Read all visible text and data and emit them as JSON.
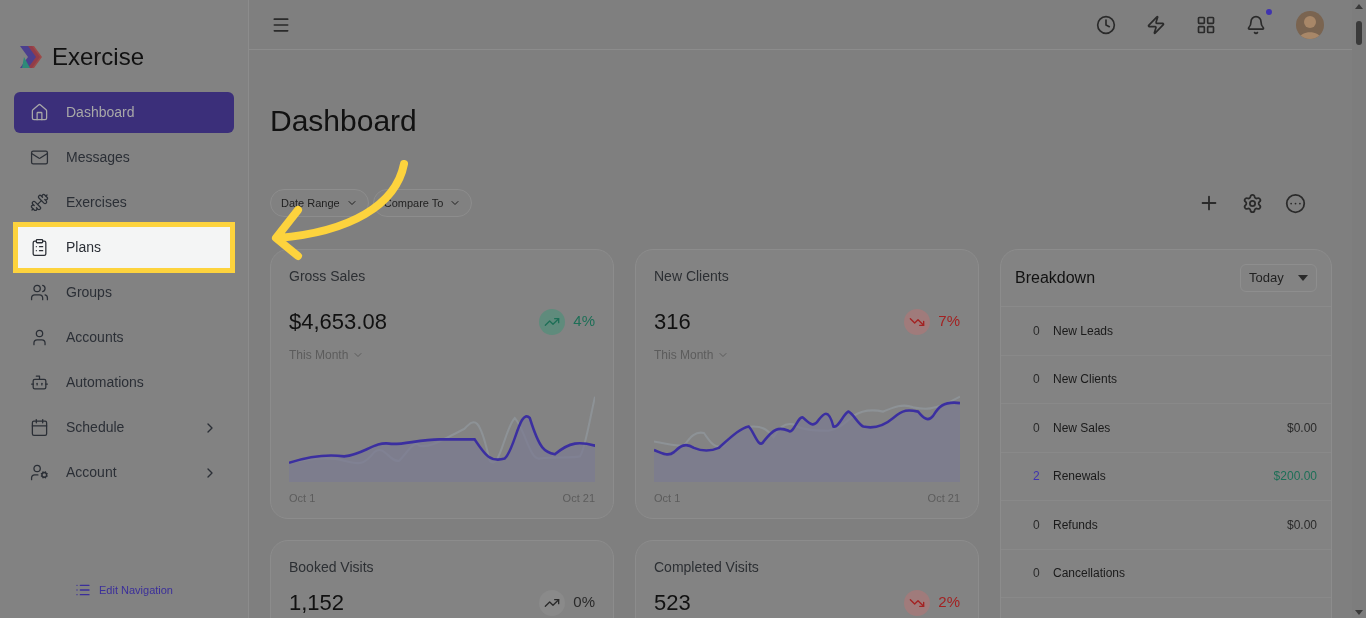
{
  "app": {
    "name": "Exercise"
  },
  "sidebar": {
    "items": [
      {
        "label": "Dashboard",
        "selected": true,
        "highlighted": false,
        "expandable": false
      },
      {
        "label": "Messages",
        "selected": false,
        "highlighted": false,
        "expandable": false
      },
      {
        "label": "Exercises",
        "selected": false,
        "highlighted": false,
        "expandable": false
      },
      {
        "label": "Plans",
        "selected": false,
        "highlighted": true,
        "expandable": false
      },
      {
        "label": "Groups",
        "selected": false,
        "highlighted": false,
        "expandable": false
      },
      {
        "label": "Accounts",
        "selected": false,
        "highlighted": false,
        "expandable": false
      },
      {
        "label": "Automations",
        "selected": false,
        "highlighted": false,
        "expandable": false
      },
      {
        "label": "Schedule",
        "selected": false,
        "highlighted": false,
        "expandable": true
      },
      {
        "label": "Account",
        "selected": false,
        "highlighted": false,
        "expandable": true
      }
    ],
    "footer_link": "Edit Navigation"
  },
  "topbar": {
    "notifications_unread": true
  },
  "page": {
    "title": "Dashboard",
    "filters": [
      "Date Range",
      "Compare To"
    ]
  },
  "cards": [
    {
      "title": "Gross Sales",
      "value": "$4,653.08",
      "kind": "up",
      "change": "4%",
      "period": "This Month",
      "start": "Oct 1",
      "end": "Oct 21"
    },
    {
      "title": "New Clients",
      "value": "316",
      "kind": "down",
      "change": "7%",
      "period": "This Month",
      "start": "Oct 1",
      "end": "Oct 21"
    },
    {
      "title": "Booked Visits",
      "value": "1,152",
      "kind": "flat",
      "change": "0%"
    },
    {
      "title": "Completed Visits",
      "value": "523",
      "kind": "down",
      "change": "2%"
    }
  ],
  "breakdown": {
    "title": "Breakdown",
    "range": "Today",
    "rows": [
      {
        "count": "0",
        "label": "New Leads",
        "highlight": false
      },
      {
        "count": "0",
        "label": "New Clients",
        "highlight": false
      },
      {
        "count": "0",
        "label": "New Sales",
        "amount": "$0.00",
        "highlight": false
      },
      {
        "count": "2",
        "label": "Renewals",
        "amount": "$200.00",
        "highlight": true
      },
      {
        "count": "0",
        "label": "Refunds",
        "amount": "$0.00",
        "highlight": false
      },
      {
        "count": "0",
        "label": "Cancellations",
        "highlight": false
      }
    ]
  }
}
